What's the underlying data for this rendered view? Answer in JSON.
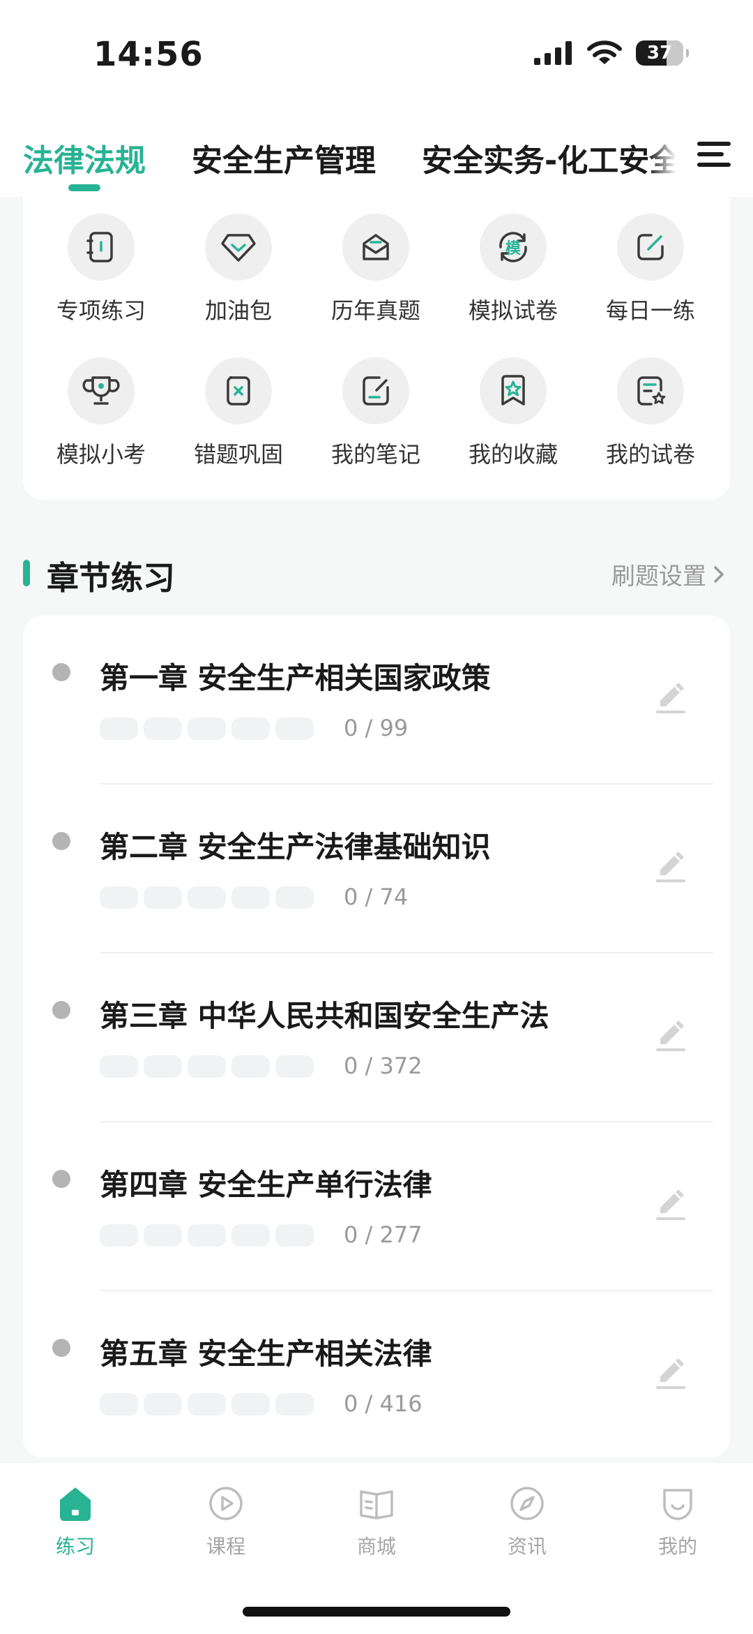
{
  "status_bar": {
    "time": "14:56",
    "battery": "37"
  },
  "top_tabs": [
    {
      "label": "法律法规",
      "active": true
    },
    {
      "label": "安全生产管理",
      "active": false
    },
    {
      "label": "安全实务-化工安全",
      "active": false
    }
  ],
  "quick_grid": [
    {
      "label": "专项练习",
      "icon": "notebook-icon"
    },
    {
      "label": "加油包",
      "icon": "diamond-icon"
    },
    {
      "label": "历年真题",
      "icon": "envelope-icon"
    },
    {
      "label": "模拟试卷",
      "icon": "mock-exam-icon",
      "icon_text": "模"
    },
    {
      "label": "每日一练",
      "icon": "edit-square-icon"
    },
    {
      "label": "模拟小考",
      "icon": "trophy-icon"
    },
    {
      "label": "错题巩固",
      "icon": "wrong-question-icon"
    },
    {
      "label": "我的笔记",
      "icon": "note-icon"
    },
    {
      "label": "我的收藏",
      "icon": "bookmark-star-icon"
    },
    {
      "label": "我的试卷",
      "icon": "paper-star-icon"
    }
  ],
  "section": {
    "title": "章节练习",
    "setting_label": "刷题设置"
  },
  "chapters": [
    {
      "title": "第一章 安全生产相关国家政策",
      "count": "0 / 99"
    },
    {
      "title": "第二章 安全生产法律基础知识",
      "count": "0 / 74"
    },
    {
      "title": "第三章 中华人民共和国安全生产法",
      "count": "0 / 372"
    },
    {
      "title": "第四章 安全生产单行法律",
      "count": "0 / 277"
    },
    {
      "title": "第五章 安全生产相关法律",
      "count": "0 / 416"
    }
  ],
  "bottom_nav": [
    {
      "label": "练习",
      "icon": "home-icon",
      "active": true
    },
    {
      "label": "课程",
      "icon": "play-circle-icon",
      "active": false
    },
    {
      "label": "商城",
      "icon": "book-open-icon",
      "active": false
    },
    {
      "label": "资讯",
      "icon": "compass-icon",
      "active": false
    },
    {
      "label": "我的",
      "icon": "profile-icon",
      "active": false
    }
  ],
  "colors": {
    "accent": "#27b394",
    "muted": "#999999",
    "background": "#f6f7f7"
  }
}
